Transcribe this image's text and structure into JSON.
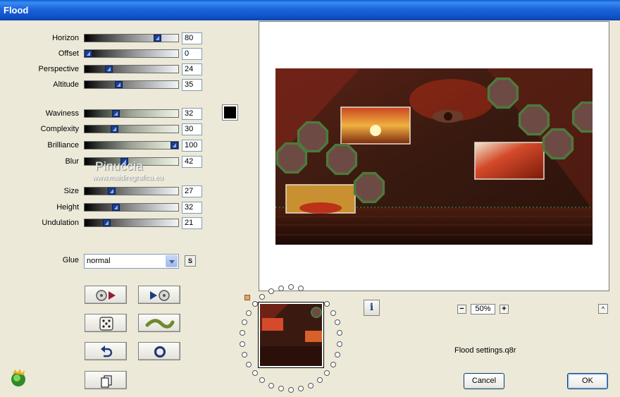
{
  "window": {
    "title": "Flood"
  },
  "sliders": [
    {
      "label": "Horizon",
      "value": "80",
      "fraction": 0.8
    },
    {
      "label": "Offset",
      "value": "0",
      "fraction": 0.0
    },
    {
      "label": "Perspective",
      "value": "24",
      "fraction": 0.24
    },
    {
      "label": "Altitude",
      "value": "35",
      "fraction": 0.35
    },
    {
      "label": "Waviness",
      "value": "32",
      "fraction": 0.32
    },
    {
      "label": "Complexity",
      "value": "30",
      "fraction": 0.3
    },
    {
      "label": "Brilliance",
      "value": "100",
      "fraction": 1.0
    },
    {
      "label": "Blur",
      "value": "42",
      "fraction": 0.42
    },
    {
      "label": "Size",
      "value": "27",
      "fraction": 0.27
    },
    {
      "label": "Height",
      "value": "32",
      "fraction": 0.32
    },
    {
      "label": "Undulation",
      "value": "21",
      "fraction": 0.21
    }
  ],
  "color_swatch": "#000000",
  "watermark": {
    "name": "Pinuccia",
    "url": "www.maidiregrafica.eu"
  },
  "glue": {
    "label": "Glue",
    "value": "normal",
    "s_button": "S"
  },
  "toolbar": {
    "icons": [
      "load-preset-icon",
      "save-preset-icon",
      "randomize-dice-icon",
      "wave-icon",
      "undo-icon",
      "reset-circle-icon",
      "copy-icon"
    ]
  },
  "zoom": {
    "minus": "−",
    "value": "50%",
    "plus": "+",
    "collapse": "^"
  },
  "info_button": "i",
  "settings_file": "Flood settings.q8r",
  "buttons": {
    "cancel": "Cancel",
    "ok": "OK"
  },
  "colors": {
    "titlebar": "#0a5fd8",
    "thumb": "#1c3f8c",
    "scene_dark": "#3a1a10",
    "frame_green": "#4c7a3c"
  }
}
